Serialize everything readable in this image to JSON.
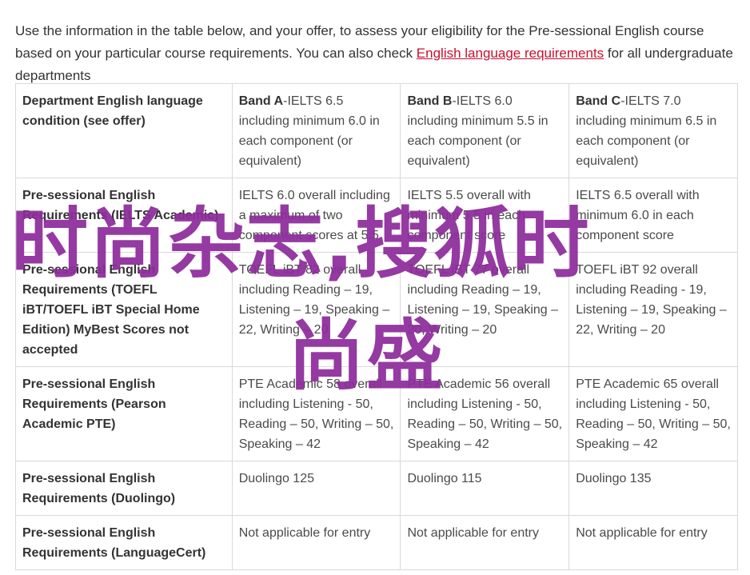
{
  "intro": {
    "text_before": "Use the information in the table below, and your offer, to assess your eligibility for the Pre-sessional English course based on your particular course requirements. You can also check ",
    "link": "English language requirements",
    "text_after": " for all undergraduate departments"
  },
  "table": {
    "header": {
      "label": "Department English language condition (see offer)",
      "bands": [
        {
          "name": "Band A",
          "desc": "-IELTS 6.5 including minimum 6.0 in each component (or equivalent)"
        },
        {
          "name": "Band B",
          "desc": "-IELTS 6.0 including minimum 5.5 in each component (or equivalent)"
        },
        {
          "name": "Band C",
          "desc": "-IELTS 7.0 including minimum 6.5 in each component (or equivalent)"
        }
      ]
    },
    "rows": [
      {
        "label": "Pre-sessional English Requirements (IELTS Academic)",
        "cells": [
          "IELTS 6.0 overall including a maximum of two component scores at 5.5",
          "IELTS 5.5 overall with minimum 5.5 in each component score",
          "IELTS 6.5 overall with minimum 6.0 in each component score"
        ]
      },
      {
        "label": "Pre-sessional English Requirements (TOEFL iBT/TOEFL iBT Special Home Edition) MyBest Scores not accepted",
        "cells": [
          "TOEFL iBT 82 overall including Reading – 19, Listening – 19, Speaking – 22, Writing – 20",
          "TOEFL iBT 77 overall including Reading – 19, Listening – 19, Speaking – 20, Writing – 20",
          "TOEFL iBT 92 overall including Reading - 19, Listening – 19, Speaking – 22, Writing – 20"
        ]
      },
      {
        "label": "Pre-sessional English Requirements (Pearson Academic PTE)",
        "cells": [
          "PTE Academic 58 overall including Listening - 50, Reading – 50, Writing – 50, Speaking – 42",
          "PTE Academic 56 overall including Listening - 50, Reading – 50, Writing – 50, Speaking – 42",
          "PTE Academic 65 overall including Listening - 50, Reading – 50, Writing – 50, Speaking – 42"
        ]
      },
      {
        "label": "Pre-sessional English Requirements (Duolingo)",
        "cells": [
          "Duolingo 125",
          "Duolingo 115",
          "Duolingo 135"
        ]
      },
      {
        "label": "Pre-sessional English Requirements (LanguageCert)",
        "cells": [
          "Not applicable for entry",
          "Not applicable for entry",
          "Not applicable for entry"
        ]
      }
    ]
  },
  "watermark": {
    "line1": "时尚杂志,搜狐时",
    "line2": "尚盛",
    "color": "#8e2c9b"
  },
  "colors": {
    "link": "#c8102e",
    "border": "#d9d9d9"
  }
}
